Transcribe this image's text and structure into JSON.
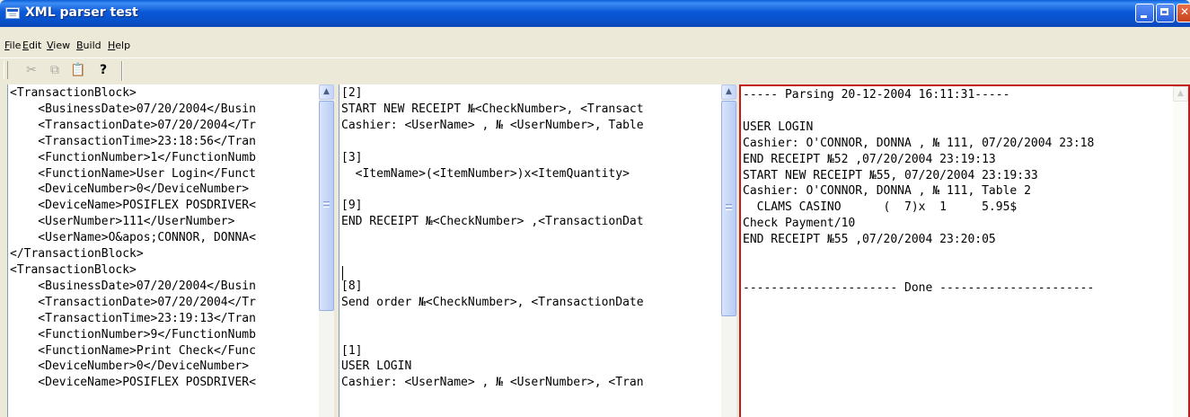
{
  "window": {
    "title": "XML parser test"
  },
  "menu": {
    "file": "File",
    "edit": "Edit",
    "view": "View",
    "build": "Build",
    "help": "Help"
  },
  "toolbar": {
    "cut": "cut-icon",
    "copy": "copy-icon",
    "paste": "paste-icon",
    "help": "help-icon"
  },
  "xml_pane": {
    "lines": [
      "<TransactionBlock>",
      "    <BusinessDate>07/20/2004</Busin",
      "    <TransactionDate>07/20/2004</Tr",
      "    <TransactionTime>23:18:56</Tran",
      "    <FunctionNumber>1</FunctionNumb",
      "    <FunctionName>User Login</Funct",
      "    <DeviceNumber>0</DeviceNumber>",
      "    <DeviceName>POSIFLEX POSDRIVER<",
      "    <UserNumber>111</UserNumber>",
      "    <UserName>O&apos;CONNOR, DONNA<",
      "</TransactionBlock>",
      "<TransactionBlock>",
      "    <BusinessDate>07/20/2004</Busin",
      "    <TransactionDate>07/20/2004</Tr",
      "    <TransactionTime>23:19:13</Tran",
      "    <FunctionNumber>9</FunctionNumb",
      "    <FunctionName>Print Check</Func",
      "    <DeviceNumber>0</DeviceNumber>",
      "    <DeviceName>POSIFLEX POSDRIVER<"
    ]
  },
  "template_pane": {
    "lines": [
      "[2]",
      "START NEW RECEIPT №<CheckNumber>, <Transact",
      "Cashier: <UserName> , № <UserNumber>, Table",
      "",
      "[3]",
      "  <ItemName>(<ItemNumber>)x<ItemQuantity>",
      "",
      "[9]",
      "END RECEIPT №<CheckNumber> ,<TransactionDat",
      "",
      "",
      "",
      "[8]",
      "Send order №<CheckNumber>, <TransactionDate",
      "",
      "",
      "[1]",
      "USER LOGIN",
      "Cashier: <UserName> , № <UserNumber>, <Tran"
    ]
  },
  "output_pane": {
    "lines": [
      "----- Parsing 20-12-2004 16:11:31-----",
      "",
      "USER LOGIN",
      "Cashier: O'CONNOR, DONNA , № 111, 07/20/2004 23:18",
      "END RECEIPT №52 ,07/20/2004 23:19:13",
      "START NEW RECEIPT №55, 07/20/2004 23:19:33",
      "Cashier: O'CONNOR, DONNA , № 111, Table 2",
      "  CLAMS CASINO      (  7)x  1     5.95$",
      "Check Payment/10",
      "END RECEIPT №55 ,07/20/2004 23:20:05",
      "",
      "",
      "---------------------- Done ----------------------"
    ]
  }
}
